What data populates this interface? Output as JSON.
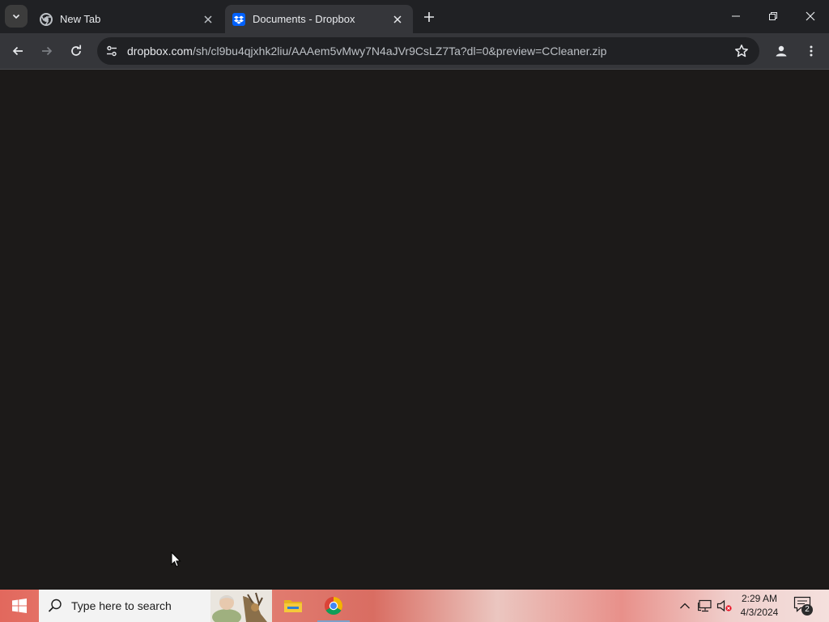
{
  "browser": {
    "tabs": [
      {
        "title": "New Tab",
        "active": false,
        "favicon": "chrome-icon"
      },
      {
        "title": "Documents - Dropbox",
        "active": true,
        "favicon": "dropbox-icon"
      }
    ],
    "address": {
      "host": "dropbox.com",
      "path": "/sh/cl9bu4qjxhk2liu/AAAem5vMwy7N4aJVr9CsLZ7Ta?dl=0&preview=CCleaner.zip"
    }
  },
  "taskbar": {
    "search_placeholder": "Type here to search",
    "apps": [
      "file-explorer-icon",
      "chrome-icon"
    ],
    "clock_time": "2:29 AM",
    "clock_date": "4/3/2024",
    "notification_count": "2"
  },
  "colors": {
    "titlebar": "#202124",
    "toolbar": "#35363a",
    "page_background": "#1c1a19"
  }
}
